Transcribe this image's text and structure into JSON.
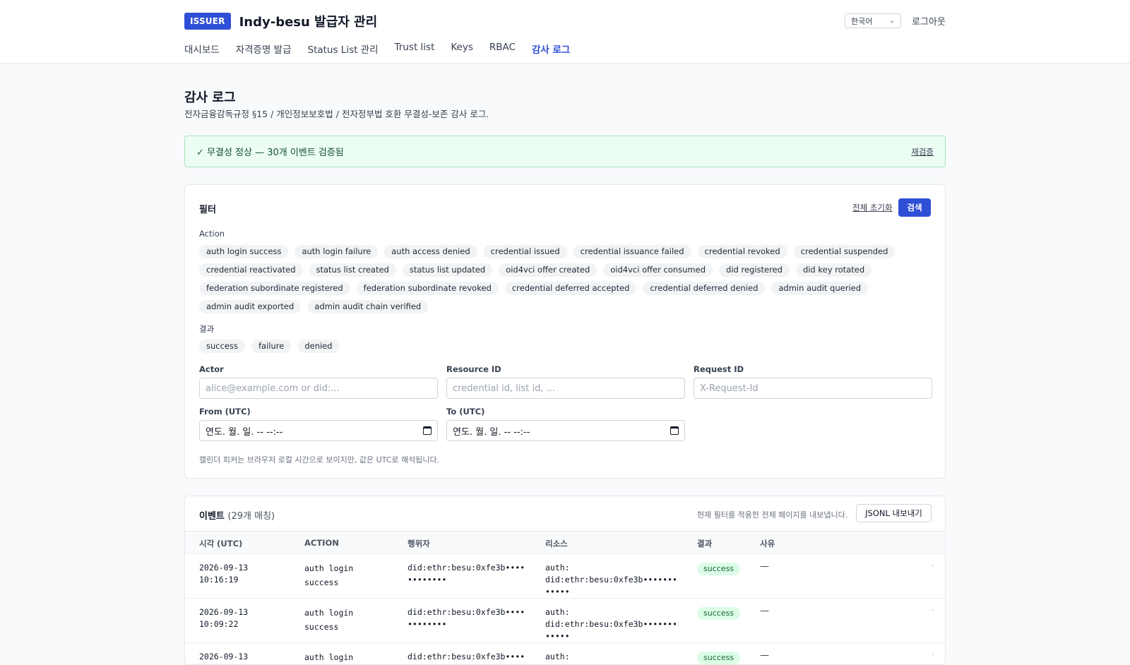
{
  "header": {
    "badge": "ISSUER",
    "title": "Indy-besu 발급자 관리",
    "language": "한국어",
    "logout": "로그아웃"
  },
  "nav": [
    {
      "label": "대시보드"
    },
    {
      "label": "자격증명 발급"
    },
    {
      "label": "Status List 관리"
    },
    {
      "label": "Trust list"
    },
    {
      "label": "Keys"
    },
    {
      "label": "RBAC"
    },
    {
      "label": "감사 로그"
    }
  ],
  "page": {
    "title": "감사 로그",
    "subtitle": "전자금융감독규정 §15 / 개인정보보호법 / 전자정부법 호환 무결성-보존 감사 로그."
  },
  "integrity": {
    "message": "✓ 무결성 정상 — 30개 이벤트 검증됨",
    "recheck": "재검증"
  },
  "filter": {
    "title": "필터",
    "reset": "전체 초기화",
    "search": "검색",
    "action_label": "Action",
    "actions": [
      "auth login success",
      "auth login failure",
      "auth access denied",
      "credential issued",
      "credential issuance failed",
      "credential revoked",
      "credential suspended",
      "credential reactivated",
      "status list created",
      "status list updated",
      "oid4vci offer created",
      "oid4vci offer consumed",
      "did registered",
      "did key rotated",
      "federation subordinate registered",
      "federation subordinate revoked",
      "credential deferred accepted",
      "credential deferred denied",
      "admin audit queried",
      "admin audit exported",
      "admin audit chain verified"
    ],
    "result_label": "결과",
    "results": [
      "success",
      "failure",
      "denied"
    ],
    "actor_label": "Actor",
    "actor_placeholder": "alice@example.com or did:...",
    "resource_label": "Resource ID",
    "resource_placeholder": "credential id, list id, ...",
    "request_label": "Request ID",
    "request_placeholder": "X-Request-Id",
    "from_label": "From (UTC)",
    "from_value": "연도. 월. 일. -- --:--",
    "to_label": "To (UTC)",
    "to_value": "연도. 월. 일. -- --:--",
    "hint": "캘린더 피커는 브라우저 로컬 시간으로 보이지만, 값은 UTC로 해석됩니다."
  },
  "events": {
    "title": "이벤트",
    "count": "(29개 매칭)",
    "export_hint": "현재 필터를 적용한 전체 페이지를 내보냅니다.",
    "export_button": "JSONL 내보내기",
    "columns": [
      "시각 (UTC)",
      "ACTION",
      "행위자",
      "리소스",
      "결과",
      "사유"
    ],
    "rows": [
      {
        "date": "2026-09-13",
        "time": "10:16:19",
        "action1": "auth login",
        "action2": "success",
        "actor1": "did:ethr:besu:0xfe3b••••",
        "actor2": "••••••••",
        "res_label": "auth:",
        "res1": "did:ethr:besu:0xfe3b•••••••",
        "res2": "•••••",
        "result": "success",
        "reason": "—",
        "more": "·"
      },
      {
        "date": "2026-09-13",
        "time": "10:09:22",
        "action1": "auth login",
        "action2": "success",
        "actor1": "did:ethr:besu:0xfe3b••••",
        "actor2": "••••••••",
        "res_label": "auth:",
        "res1": "did:ethr:besu:0xfe3b•••••••",
        "res2": "•••••",
        "result": "success",
        "reason": "—",
        "more": "·"
      },
      {
        "date": "2026-09-13",
        "time": "",
        "action1": "auth login",
        "action2": "",
        "actor1": "did:ethr:besu:0xfe3b••••",
        "actor2": "",
        "res_label": "auth:",
        "res1": "",
        "res2": "",
        "result": "success",
        "reason": "—",
        "more": "·"
      }
    ]
  }
}
